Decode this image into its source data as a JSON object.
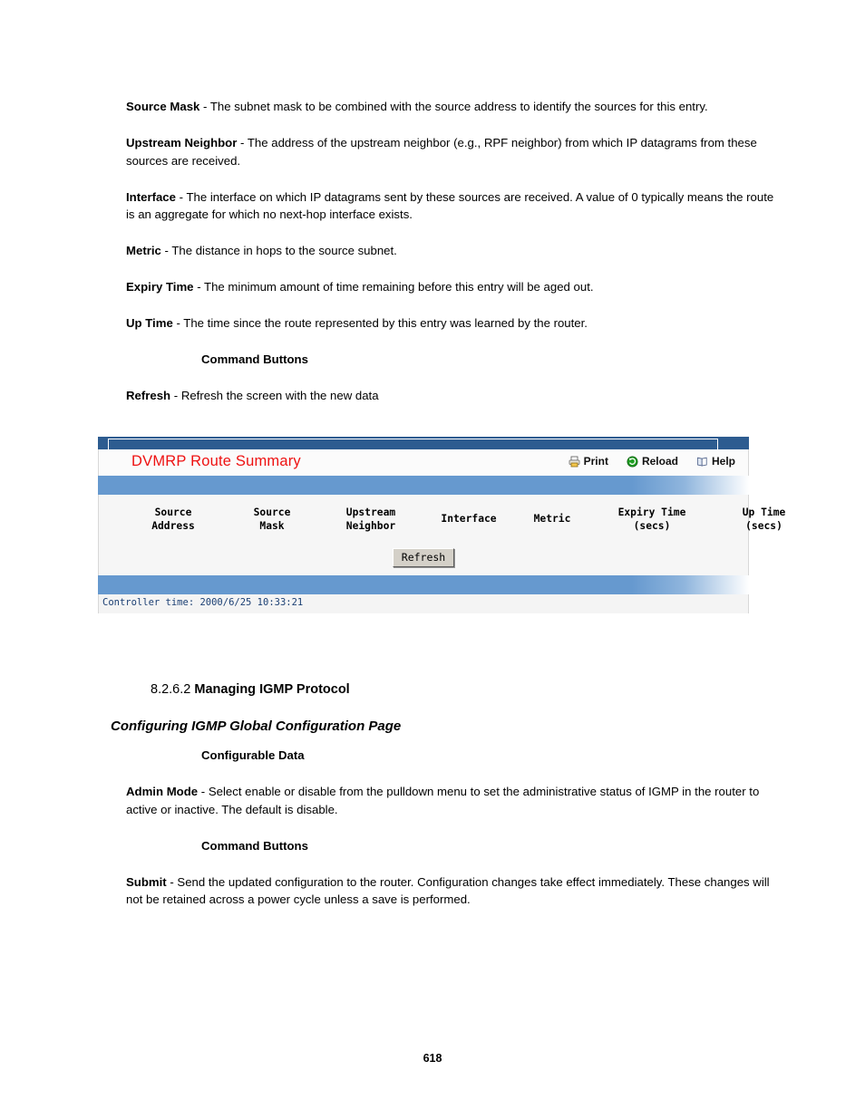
{
  "document": {
    "top_paragraphs": [
      {
        "term": "Source Mask",
        "text": " - The subnet mask to be combined with the source address to identify the sources for this entry."
      },
      {
        "term": "Upstream Neighbor",
        "text": " - The address of the upstream neighbor (e.g., RPF neighbor) from which IP datagrams from these sources are received."
      },
      {
        "term": "Interface",
        "text": " - The interface on which IP datagrams sent by these sources are received. A value of 0 typically means the route is an aggregate for which no next-hop interface exists."
      },
      {
        "term": "Metric",
        "text": " - The distance in hops to the source subnet."
      },
      {
        "term": "Expiry Time",
        "text": " - The minimum amount of time remaining before this entry will be aged out."
      },
      {
        "term": "Up Time",
        "text": " - The time since the route represented by this entry was learned by the router."
      }
    ],
    "command_buttons_heading": "Command Buttons",
    "refresh_paragraph": {
      "term": "Refresh",
      "text": " - Refresh the screen with the new data"
    },
    "section": {
      "number": "8.2.6.2 ",
      "title": "Managing IGMP Protocol",
      "subtitle": "Configuring IGMP Global Configuration Page",
      "configurable_data_heading": "Configurable Data",
      "admin_mode": {
        "term": "Admin Mode",
        "text": " - Select enable or disable from the pulldown menu to set the administrative status of IGMP in the router to active or inactive. The default is disable."
      },
      "command_buttons_heading": "Command Buttons",
      "submit": {
        "term": "Submit",
        "text": " - Send the updated configuration to the router. Configuration changes take effect immediately. These changes will not be retained across a power cycle unless a save is performed."
      }
    },
    "page_number": "618"
  },
  "screenshot": {
    "title": "DVMRP Route Summary",
    "toolbar": [
      {
        "icon": "print-icon",
        "label": "Print"
      },
      {
        "icon": "reload-icon",
        "label": "Reload"
      },
      {
        "icon": "help-icon",
        "label": "Help"
      }
    ],
    "table": {
      "columns": [
        "Source\nAddress",
        "Source\nMask",
        "Upstream\nNeighbor",
        "Interface",
        "Metric",
        "Expiry Time\n(secs)",
        "Up Time\n(secs)"
      ],
      "rows": []
    },
    "refresh_button": "Refresh",
    "controller_time": "Controller time: 2000/6/25 10:33:21",
    "colors": {
      "title_red": "#ee1111",
      "header_dark_blue": "#2d5c90",
      "band_blue": "#6699cf",
      "controller_time_blue": "#1b3f73"
    }
  }
}
